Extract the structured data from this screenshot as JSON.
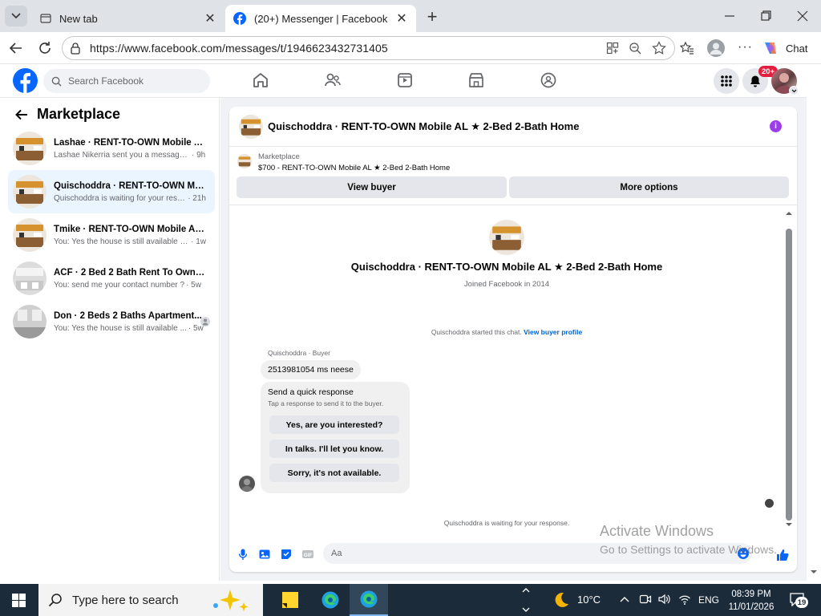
{
  "browser": {
    "tabs": [
      {
        "title": "New tab",
        "active": false
      },
      {
        "title": "(20+) Messenger | Facebook",
        "active": true
      }
    ],
    "url": "https://www.facebook.com/messages/t/1946623432731405",
    "chat_label": "Chat"
  },
  "fb": {
    "search_placeholder": "Search Facebook",
    "notif_badge": "20+"
  },
  "left": {
    "title": "Marketplace",
    "conversations": [
      {
        "name": "Lashae · RENT-TO-OWN Mobile A...",
        "message": "Lashae Nikerria sent you a message a...",
        "time": "· 9h"
      },
      {
        "name": "Quischoddra · RENT-TO-OWN Mo...",
        "message": "Quischoddra is waiting for your resp...",
        "time": "· 21h"
      },
      {
        "name": "Tmike · RENT-TO-OWN Mobile AL ...",
        "message": "You: Yes the house is still available for...",
        "time": "· 1w"
      },
      {
        "name": "ACF · 2 Bed 2 Bath Rent To Own A...",
        "message": "You: send me your contact number ?",
        "time": "· 5w"
      },
      {
        "name": "Don · 2 Beds 2 Baths Apartment...",
        "message": "You: Yes the house is still available ...",
        "time": "· 5w"
      }
    ]
  },
  "chat": {
    "header_title": "Quischoddra · RENT-TO-OWN Mobile AL ★ 2-Bed 2-Bath Home",
    "listing_category": "Marketplace",
    "listing_price": "$700 - RENT-TO-OWN Mobile AL ★ 2-Bed 2-Bath Home",
    "view_buyer": "View buyer",
    "more_options": "More options",
    "profile_name": "Quischoddra · RENT-TO-OWN Mobile AL ★ 2-Bed 2-Bath Home",
    "profile_joined": "Joined Facebook in 2014",
    "started_text": "Quischoddra started this chat.",
    "view_buyer_profile": "View buyer profile",
    "sender_label": "Quischoddra · Buyer",
    "message1": "2513981054 ms neese",
    "quick_title": "Send a quick response",
    "quick_sub": "Tap a response to send it to the buyer.",
    "quick_options": [
      "Yes, are you interested?",
      "In talks. I'll let you know.",
      "Sorry, it's not available."
    ],
    "waiting_text": "Quischoddra is waiting for your response.",
    "composer_placeholder": "Aa"
  },
  "watermark": {
    "line1": "Activate Windows",
    "line2": "Go to Settings to activate Windows."
  },
  "taskbar": {
    "search_placeholder": "Type here to search",
    "temperature": "10°C",
    "language": "ENG",
    "time": "08:39 PM",
    "date": "11/01/2026",
    "notif_count": "19"
  },
  "colors": {
    "fb_blue": "#0866ff",
    "badge_red": "#e41e3f",
    "selected_row": "#ebf5ff",
    "taskbar": "#1c2b3a"
  }
}
